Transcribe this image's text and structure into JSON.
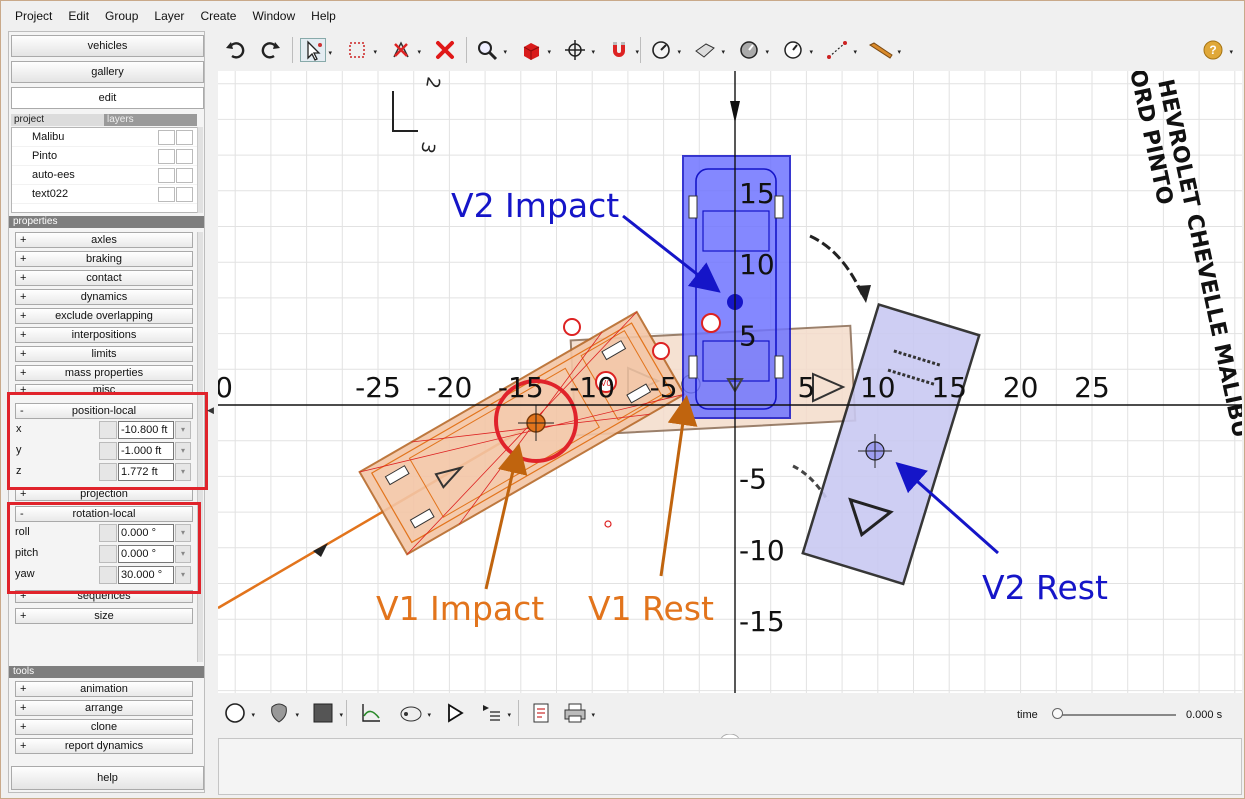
{
  "menu": [
    "Project",
    "Edit",
    "Group",
    "Layer",
    "Create",
    "Window",
    "Help"
  ],
  "left_panel": {
    "nav_buttons": [
      "vehicles",
      "gallery",
      "edit"
    ],
    "project_tabs": {
      "project": "project",
      "layers": "layers"
    },
    "project_items": [
      "Malibu",
      "Pinto",
      "auto-ees",
      "text022"
    ],
    "properties_head": "properties",
    "properties": [
      "axles",
      "braking",
      "contact",
      "dynamics",
      "exclude overlapping",
      "interpositions",
      "limits",
      "mass properties",
      "misc"
    ],
    "position_local": {
      "label": "position-local",
      "fields": [
        {
          "name": "x",
          "value": "-10.800 ft"
        },
        {
          "name": "y",
          "value": "-1.000 ft"
        },
        {
          "name": "z",
          "value": "1.772 ft"
        }
      ]
    },
    "projection": "projection",
    "rotation_local": {
      "label": "rotation-local",
      "fields": [
        {
          "name": "roll",
          "value": "0.000 °"
        },
        {
          "name": "pitch",
          "value": "0.000 °"
        },
        {
          "name": "yaw",
          "value": "30.000 °"
        }
      ]
    },
    "after_props": [
      "sequences",
      "size"
    ],
    "tools_head": "tools",
    "tools": [
      "animation",
      "arrange",
      "clone",
      "report dynamics"
    ],
    "help": "help",
    "plus": "+",
    "minus": "-"
  },
  "canvas": {
    "x_ticks": [
      "0",
      "-25",
      "-20",
      "-15",
      "-10",
      "-5",
      "5",
      "10",
      "15",
      "20",
      "25"
    ],
    "y_ticks": [
      "15",
      "10",
      "5",
      "-5",
      "-10",
      "-15"
    ],
    "labels": {
      "v2_impact": "V2 Impact",
      "v1_impact": "V1 Impact",
      "v1_rest": "V1 Rest",
      "v2_rest": "V2 Rest"
    },
    "diagram_text": {
      "vehicle_names": [
        "HEVROLET CHEVELLE MALIBU",
        "ORD PINTO"
      ],
      "markers": [
        "2",
        "3"
      ]
    },
    "colors": {
      "v1": "#e2741c",
      "v2": "#1515c8",
      "highlight": "#e0232b",
      "rest_box": "#c9c9f2"
    }
  },
  "bottom": {
    "time_label": "time",
    "time_value": "0.000 s"
  }
}
